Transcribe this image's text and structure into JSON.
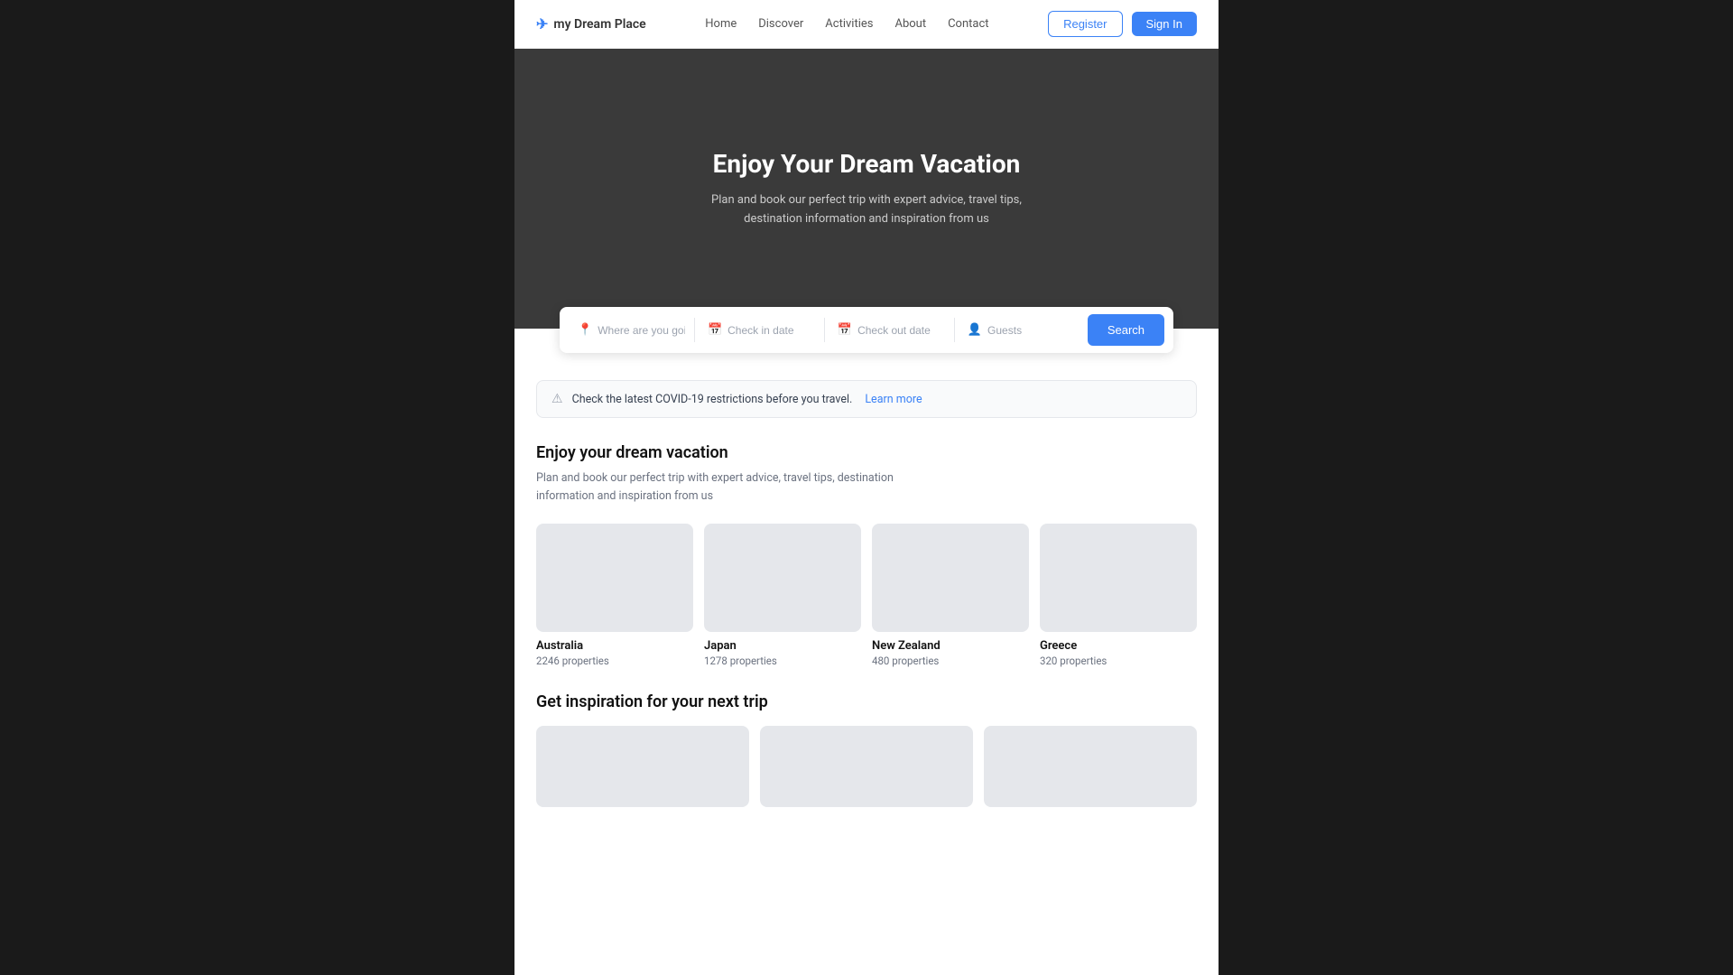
{
  "brand": {
    "icon": "✈",
    "name": "my Dream Place"
  },
  "nav": {
    "links": [
      "Home",
      "Discover",
      "Activities",
      "About",
      "Contact"
    ],
    "register_label": "Register",
    "signin_label": "Sign In"
  },
  "hero": {
    "title": "Enjoy Your Dream Vacation",
    "subtitle": "Plan and book our perfect trip with expert advice, travel tips, destination information and  inspiration from us"
  },
  "search": {
    "where_placeholder": "Where are you going?",
    "checkin_placeholder": "Check in date",
    "checkout_placeholder": "Check out date",
    "guests_placeholder": "Guests",
    "button_label": "Search"
  },
  "covid_banner": {
    "text": "Check the latest COVID-19 restrictions before you travel.",
    "link_text": "Learn more"
  },
  "destinations_section": {
    "title": "Enjoy your dream vacation",
    "description": "Plan and book our perfect trip with expert advice, travel tips, destination information and inspiration from us",
    "destinations": [
      {
        "name": "Australia",
        "count": "2246 properties"
      },
      {
        "name": "Japan",
        "count": "1278 properties"
      },
      {
        "name": "New Zealand",
        "count": "480 properties"
      },
      {
        "name": "Greece",
        "count": "320 properties"
      }
    ]
  },
  "inspiration_section": {
    "title": "Get inspiration for your next trip",
    "cards": [
      {
        "id": "card-1"
      },
      {
        "id": "card-2"
      },
      {
        "id": "card-3"
      }
    ]
  }
}
